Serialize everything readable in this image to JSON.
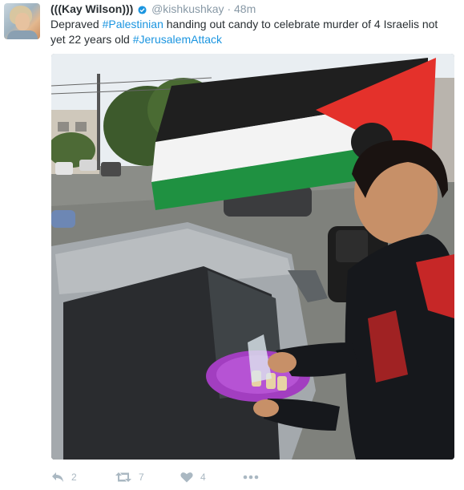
{
  "tweet": {
    "name": "(((Kay Wilson)))",
    "handle": "@kishkushkay",
    "separator": "·",
    "time": "48m",
    "text_parts": [
      {
        "text": "Depraved ",
        "type": "text"
      },
      {
        "text": "#Palestinian",
        "type": "hashtag"
      },
      {
        "text": " handing out candy to celebrate murder of 4 Israelis not yet 22 years old ",
        "type": "text"
      },
      {
        "text": "#JerusalemAttack",
        "type": "hashtag"
      }
    ]
  },
  "actions": {
    "reply": {
      "icon": "reply-icon",
      "count": "2"
    },
    "retweet": {
      "icon": "retweet-icon",
      "count": "7"
    },
    "like": {
      "icon": "heart-icon",
      "count": "4"
    },
    "more": {
      "icon": "more-icon"
    }
  },
  "colors": {
    "text": "#292f33",
    "muted": "#8899a6",
    "hashtag": "#1b95e0",
    "action": "#aab8c2"
  }
}
